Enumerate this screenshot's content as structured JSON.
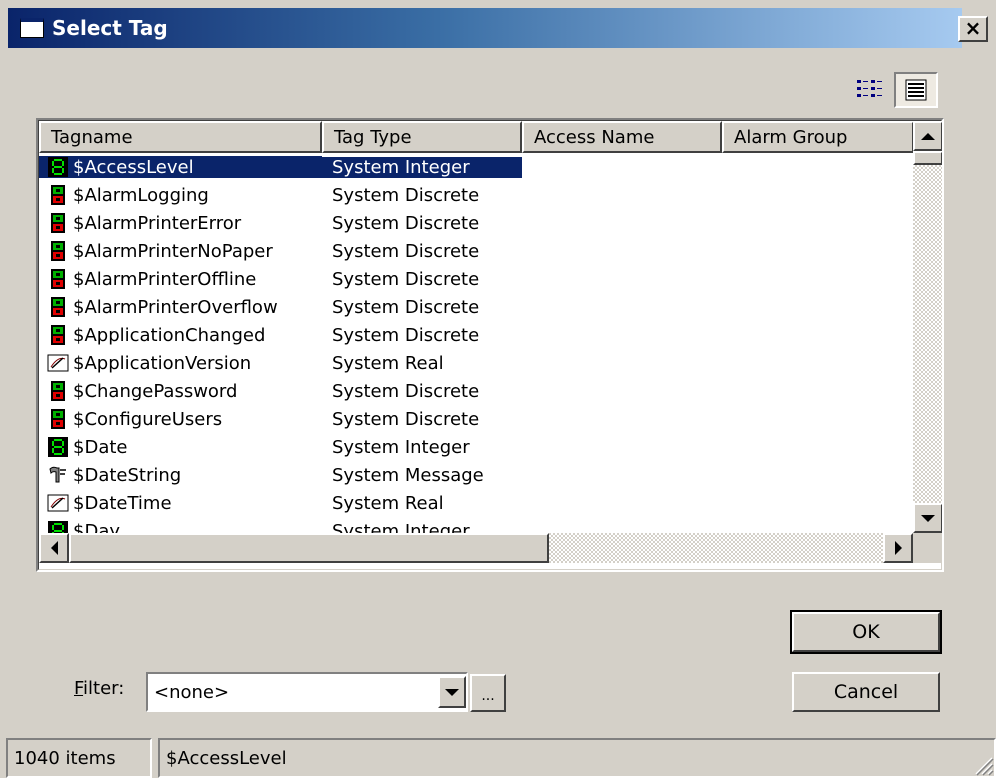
{
  "window": {
    "title": "Select Tag",
    "close_label": "×"
  },
  "toolbar": {
    "list_view_icon": "list-view-icon",
    "details_view_icon": "details-view-icon"
  },
  "list": {
    "columns": [
      "Tagname",
      "Tag Type",
      "Access Name",
      "Alarm Group"
    ],
    "selected_index": 0,
    "rows": [
      {
        "icon": "integer",
        "tagname": "$AccessLevel",
        "type": "System Integer"
      },
      {
        "icon": "discrete",
        "tagname": "$AlarmLogging",
        "type": "System Discrete"
      },
      {
        "icon": "discrete",
        "tagname": "$AlarmPrinterError",
        "type": "System Discrete"
      },
      {
        "icon": "discrete",
        "tagname": "$AlarmPrinterNoPaper",
        "type": "System Discrete"
      },
      {
        "icon": "discrete",
        "tagname": "$AlarmPrinterOffline",
        "type": "System Discrete"
      },
      {
        "icon": "discrete",
        "tagname": "$AlarmPrinterOverflow",
        "type": "System Discrete"
      },
      {
        "icon": "discrete",
        "tagname": "$ApplicationChanged",
        "type": "System Discrete"
      },
      {
        "icon": "real",
        "tagname": "$ApplicationVersion",
        "type": "System Real"
      },
      {
        "icon": "discrete",
        "tagname": "$ChangePassword",
        "type": "System Discrete"
      },
      {
        "icon": "discrete",
        "tagname": "$ConfigureUsers",
        "type": "System Discrete"
      },
      {
        "icon": "integer",
        "tagname": "$Date",
        "type": "System Integer"
      },
      {
        "icon": "message",
        "tagname": "$DateString",
        "type": "System Message"
      },
      {
        "icon": "real",
        "tagname": "$DateTime",
        "type": "System Real"
      },
      {
        "icon": "integer",
        "tagname": "$Day",
        "type": "System Integer"
      }
    ]
  },
  "buttons": {
    "ok": "OK",
    "cancel": "Cancel",
    "browse": "..."
  },
  "filter": {
    "label_accel": "F",
    "label_rest": "ilter:",
    "value": "<none>"
  },
  "status": {
    "count": "1040 items",
    "selected": "$AccessLevel"
  },
  "colors": {
    "selection": "#0a246a",
    "face": "#d4d0c8"
  }
}
